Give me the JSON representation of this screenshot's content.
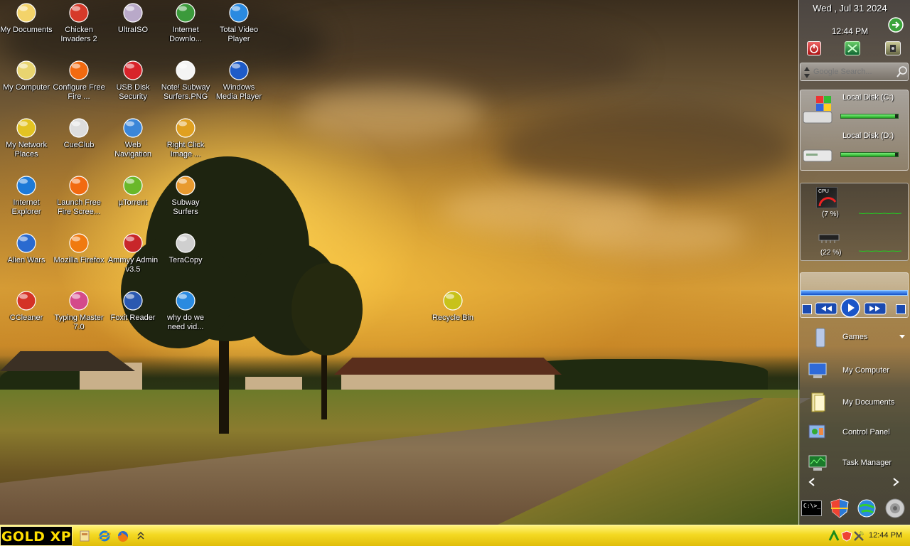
{
  "desktop_icons": [
    {
      "label": "My Documents",
      "icon": "my-documents-icon"
    },
    {
      "label": "Chicken Invaders 2",
      "icon": "chicken-invaders-icon"
    },
    {
      "label": "UltraISO",
      "icon": "ultraiso-disc-icon"
    },
    {
      "label": "Internet Downlo...",
      "icon": "internet-download-manager-icon"
    },
    {
      "label": "Total Video Player",
      "icon": "total-video-player-icon"
    },
    {
      "label": "My Computer",
      "icon": "my-computer-icon"
    },
    {
      "label": "Configure Free Fire ...",
      "icon": "configure-free-fire-icon"
    },
    {
      "label": "USB Disk Security",
      "icon": "usb-disk-security-icon"
    },
    {
      "label": "Note! Subway Surfers.PNG",
      "icon": "png-file-icon"
    },
    {
      "label": "Windows Media Player",
      "icon": "windows-media-player-icon"
    },
    {
      "label": "My Network Places",
      "icon": "my-network-places-icon"
    },
    {
      "label": "CueClub",
      "icon": "cueclub-icon"
    },
    {
      "label": "Web Navigation",
      "icon": "web-navigation-globe-icon"
    },
    {
      "label": "Right Click Image ...",
      "icon": "right-click-image-icon"
    },
    {
      "label": "Internet Explorer",
      "icon": "internet-explorer-icon"
    },
    {
      "label": "Launch Free Fire Scree...",
      "icon": "launch-free-fire-icon"
    },
    {
      "label": "µTorrent",
      "icon": "utorrent-icon"
    },
    {
      "label": "Subway Surfers",
      "icon": "subway-surfers-icon"
    },
    {
      "label": "Alien Wars",
      "icon": "alien-wars-icon"
    },
    {
      "label": "Mozilla Firefox",
      "icon": "firefox-icon"
    },
    {
      "label": "Ammyy Admin v3.5",
      "icon": "ammyy-admin-icon"
    },
    {
      "label": "TeraCopy",
      "icon": "teracopy-icon"
    },
    {
      "label": "CCleaner",
      "icon": "ccleaner-icon"
    },
    {
      "label": "Typing Master 7.0",
      "icon": "typing-master-icon"
    },
    {
      "label": "Foxit Reader",
      "icon": "foxit-reader-icon"
    },
    {
      "label": "why do we need vid...",
      "icon": "shortcut-file-icon"
    },
    {
      "label": "Recycle Bin",
      "icon": "recycle-bin-icon"
    }
  ],
  "sidebar": {
    "date": "Wed , Jul 31 2024",
    "time": "12:44 PM",
    "power_buttons": [
      "power-off-icon",
      "restart-icon",
      "logoff-icon"
    ],
    "search": {
      "placeholder": "Google Search..."
    },
    "disks": [
      {
        "label": "Local Disk (C:)",
        "usage": 0.95
      },
      {
        "label": "Local Disk (D:)",
        "usage": 0.95
      }
    ],
    "monitor": [
      {
        "label": "(7 %)",
        "value": 7,
        "kind": "CPU"
      },
      {
        "label": "(22 %)",
        "value": 22,
        "kind": "RAM"
      }
    ],
    "media": {
      "progress": 1.0
    },
    "links": [
      {
        "label": "Games",
        "icon": "games-folder-icon"
      },
      {
        "label": "My Computer",
        "icon": "my-computer-icon"
      },
      {
        "label": "My Documents",
        "icon": "my-documents-folder-icon"
      },
      {
        "label": "Control Panel",
        "icon": "control-panel-icon"
      },
      {
        "label": "Task Manager",
        "icon": "task-manager-icon"
      }
    ],
    "bottom_icons": [
      "command-prompt-icon",
      "security-shield-icon",
      "network-globe-icon",
      "audio-speaker-icon"
    ],
    "cpu_badge": "CPU"
  },
  "taskbar": {
    "start_label": "GOLD XP",
    "quick_launch": [
      "show-desktop-icon",
      "internet-explorer-icon",
      "firefox-icon",
      "chevron-expand-icon"
    ],
    "tray_time": "12:44 PM",
    "colors": {
      "bar": "#f4d922",
      "start_bg": "#000000",
      "start_text": "#ffde00"
    }
  }
}
